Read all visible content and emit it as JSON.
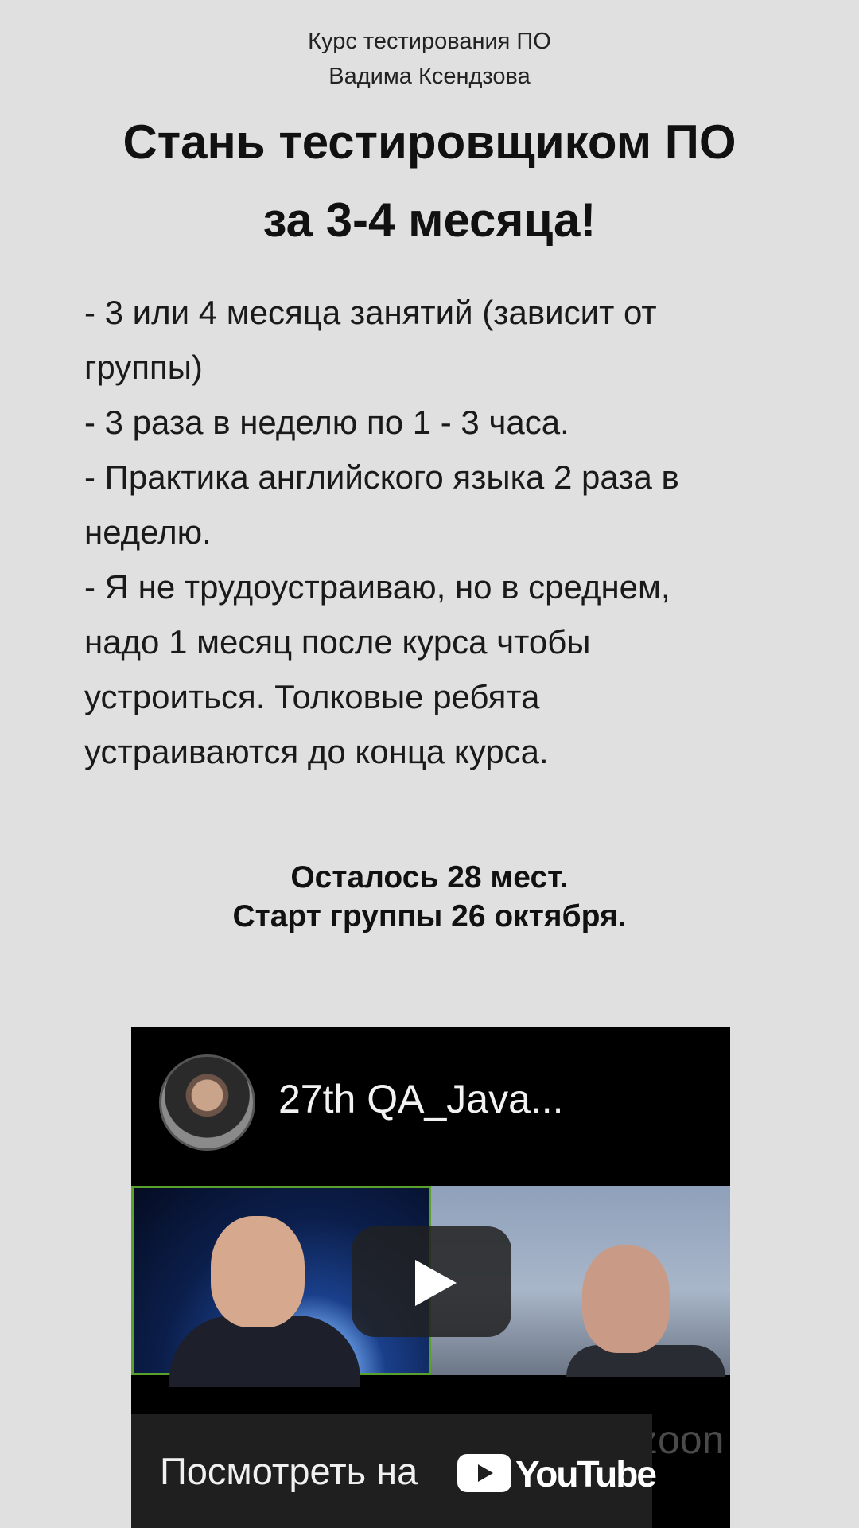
{
  "subtitle": {
    "line1": "Курс тестирования ПО",
    "line2": "Вадима Ксендзова"
  },
  "headline": {
    "line1": "Стань тестировщиком ПО",
    "line2": "за 3-4 месяца!"
  },
  "features": {
    "lines": [
      "- 3 или 4 месяца занятий (зависит от",
      "группы)",
      "- 3 раза в неделю по 1 - 3 часа.",
      "- Практика английского языка 2 раза в",
      "неделю.",
      "- Я не трудоустраиваю, но в среднем,",
      "надо 1 месяц после курса чтобы",
      "устроиться. Толковые ребята",
      "устраиваются до конца курса."
    ]
  },
  "notice": {
    "seats": "Осталось 28 мест.",
    "start": "Старт группы 26 октября."
  },
  "video": {
    "title": "27th QA_Java...",
    "watch_label": "Посмотреть на",
    "platform": "YouTube",
    "overlay_mark": "zoon",
    "icons": {
      "avatar": "channel-avatar",
      "menu": "more-vert-icon",
      "play": "play-icon",
      "platform_logo": "youtube-logo-icon"
    }
  },
  "colors": {
    "background": "#e0e0e0",
    "text": "#111111",
    "video_bg": "#000000",
    "active_speaker_border": "#5aa02c"
  }
}
